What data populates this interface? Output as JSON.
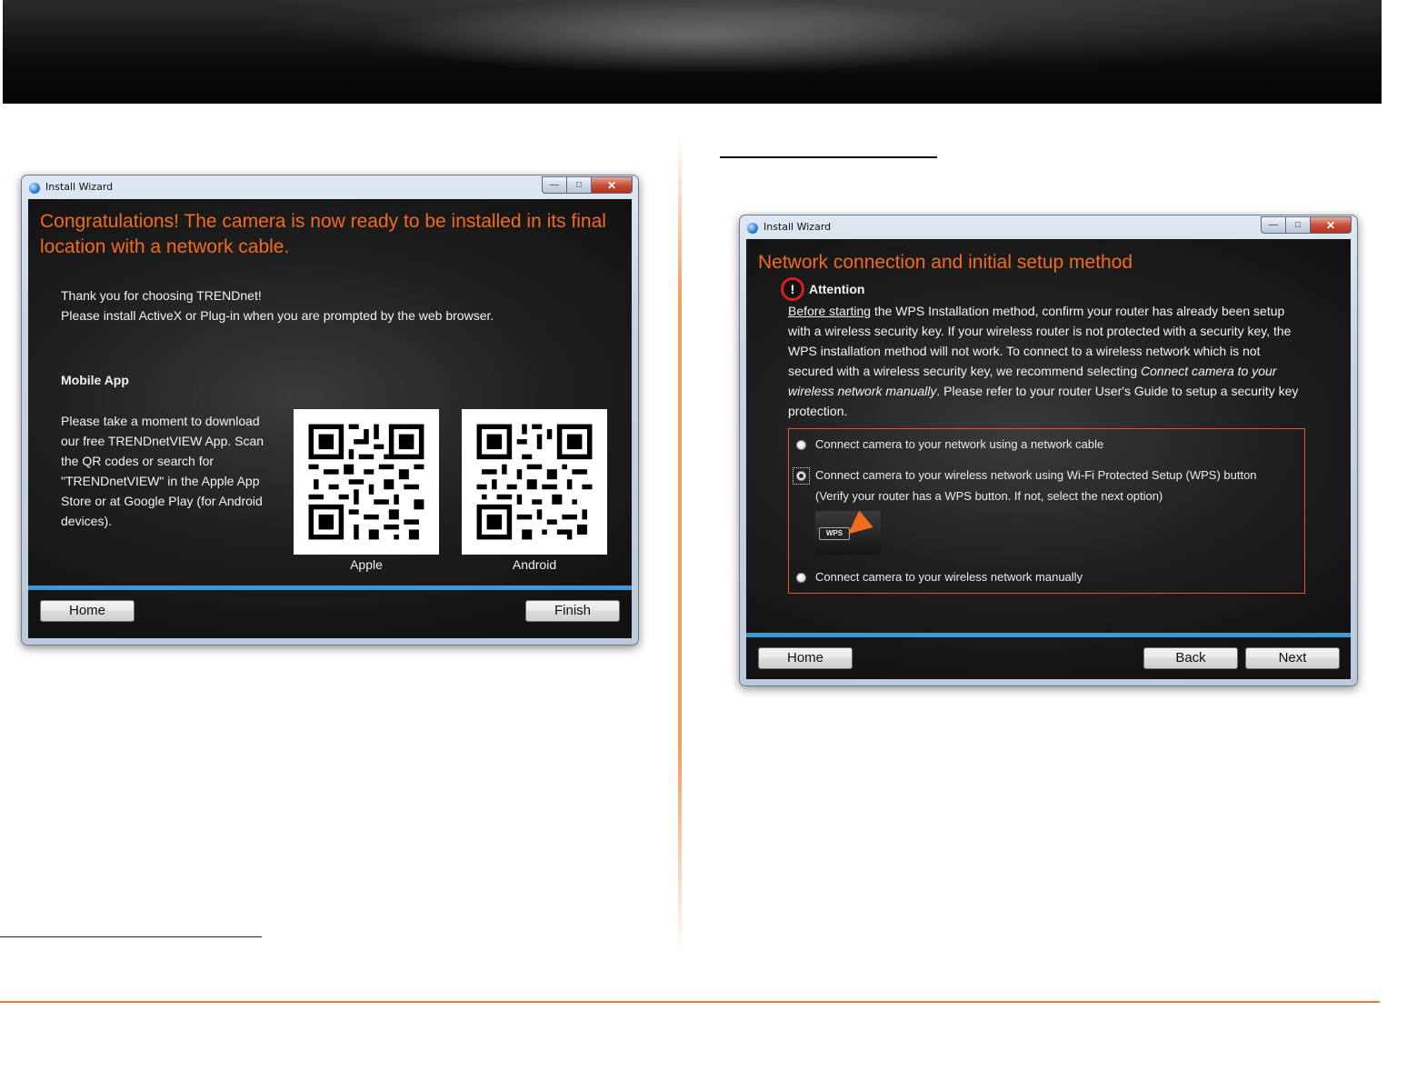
{
  "left_window": {
    "title": "Install Wizard",
    "heading": "Congratulations! The camera is now ready to be installed in its final location with a network cable.",
    "thanks_line1": "Thank you for choosing TRENDnet!",
    "thanks_line2": "Please install ActiveX or Plug-in when you are prompted by the web browser.",
    "mobile_app_title": "Mobile App",
    "mobile_app_text": "Please take a moment to download our free TRENDnetVIEW App. Scan the QR codes or search for \"TRENDnetVIEW\" in the Apple App Store or at Google Play (for Android devices).",
    "qr_apple_label": "Apple",
    "qr_android_label": "Android",
    "home_button": "Home",
    "finish_button": "Finish"
  },
  "right_window": {
    "title": "Install Wizard",
    "heading": "Network connection and initial setup method",
    "attention_label": "Attention",
    "attention_mark": "!",
    "attention_underlined": "Before starting",
    "attention_p1": " the WPS Installation method, confirm your router has already been setup with a wireless security key. If your wireless router is not protected with a security key, the WPS installation method will not work. To connect to a wireless network which is not secured with a wireless security key, we recommend selecting ",
    "attention_italic": "Connect camera to your wireless network manually",
    "attention_p2": ". Please refer to your router User's Guide to setup a security key protection.",
    "options": [
      {
        "label": "Connect camera to your network using a network cable",
        "selected": false
      },
      {
        "label": "Connect camera to your wireless network using Wi-Fi Protected Setup (WPS) button",
        "sublabel": "(Verify your router has a WPS button. If not, select the next option)",
        "selected": true
      },
      {
        "label": "Connect camera to your wireless network manually",
        "selected": false
      }
    ],
    "wps_badge": "WPS",
    "home_button": "Home",
    "back_button": "Back",
    "next_button": "Next"
  },
  "colors": {
    "accent_orange": "#f26b21",
    "progress_blue": "#3d99d4",
    "attention_red": "#d62020"
  }
}
